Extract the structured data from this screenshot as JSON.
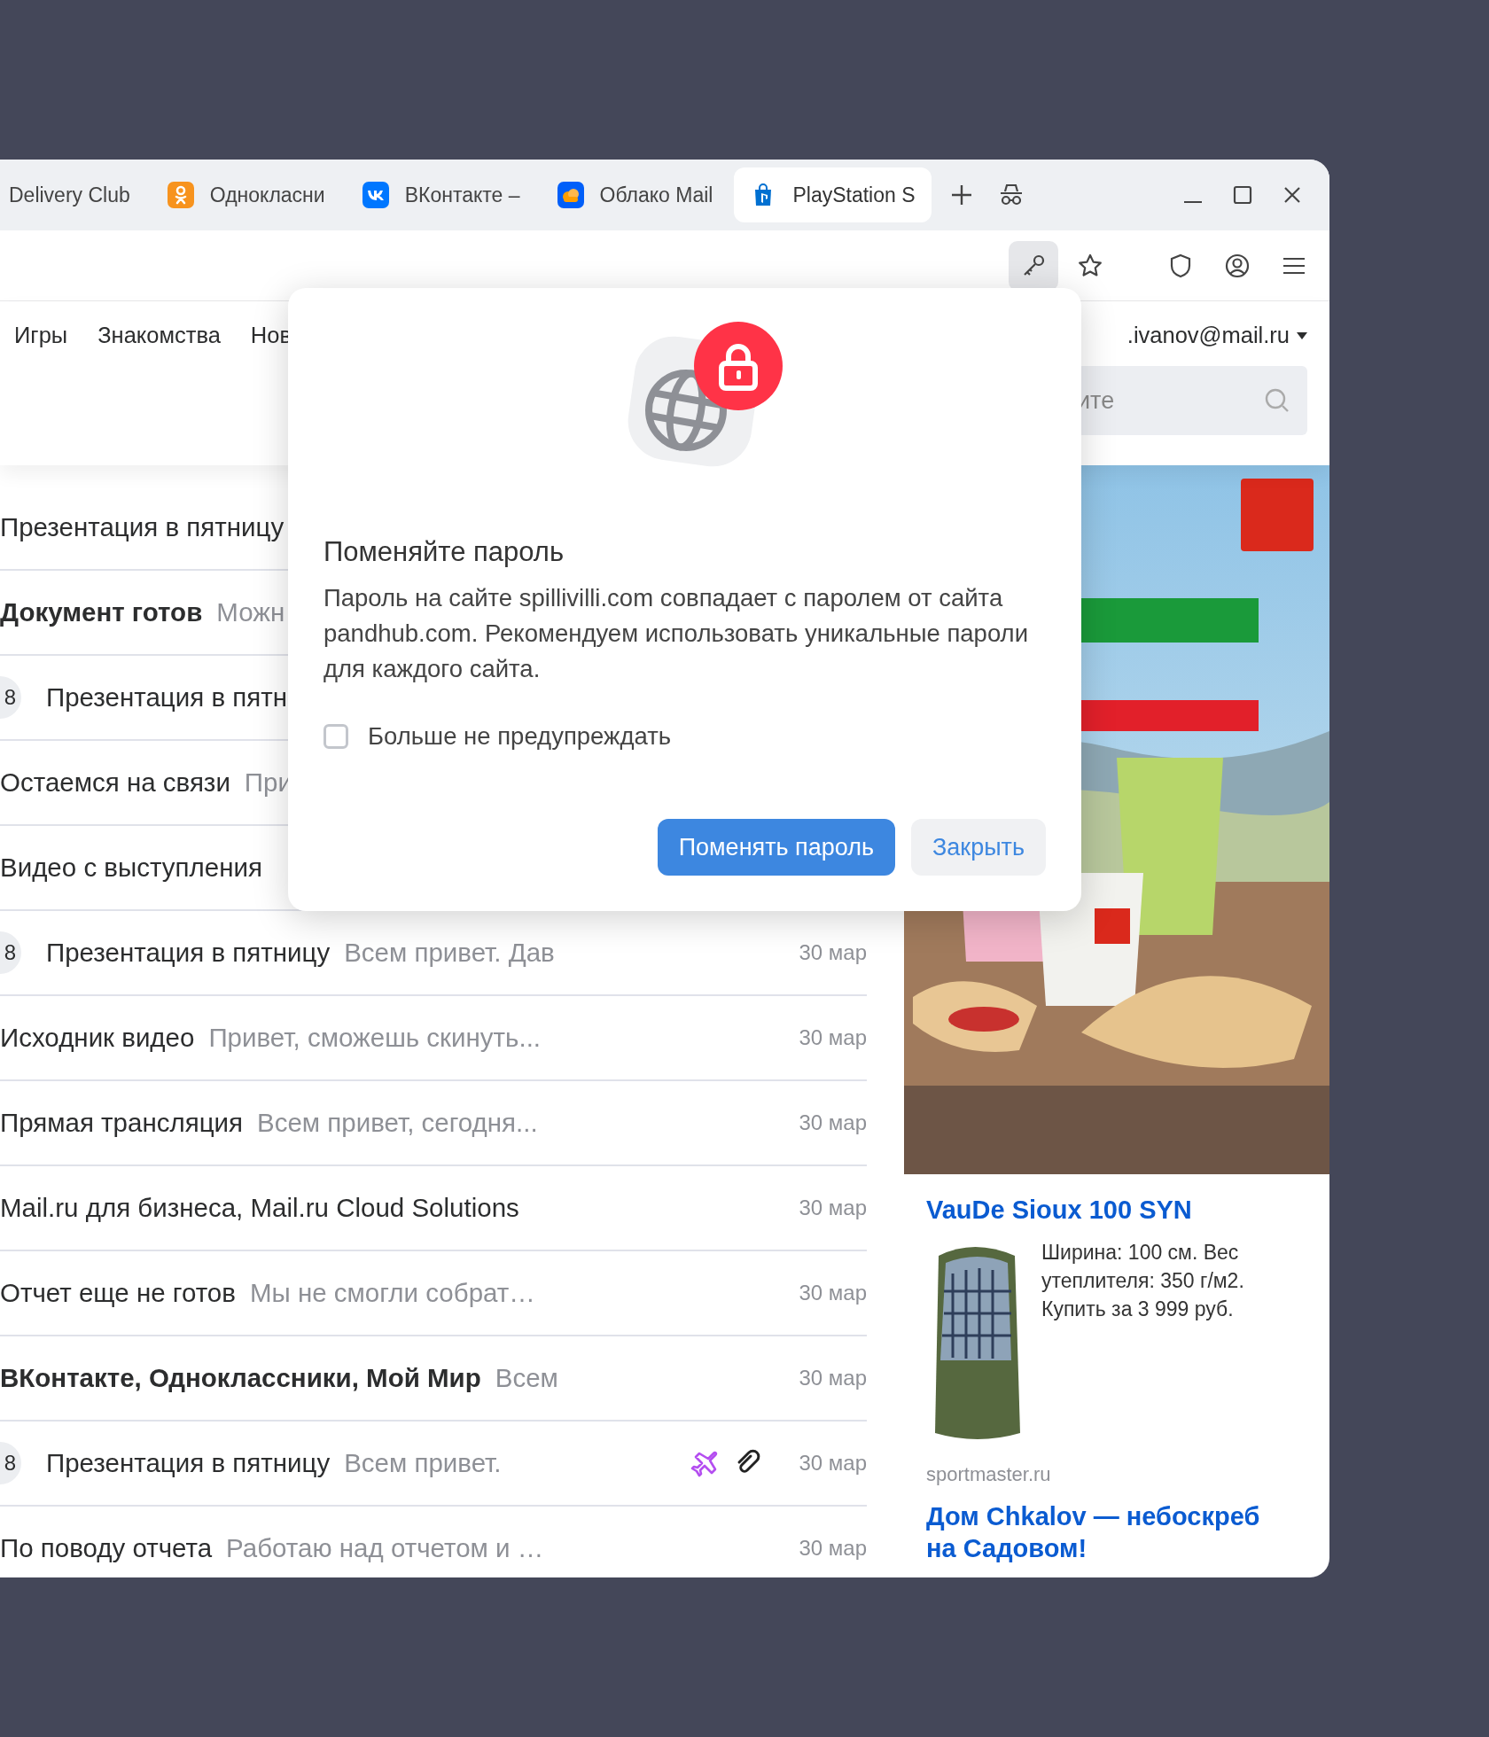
{
  "tabs": [
    {
      "label": "Delivery Club",
      "kind": "plain",
      "selected": false
    },
    {
      "label": "Однокласни",
      "kind": "ok",
      "selected": false
    },
    {
      "label": "ВКонтакте –",
      "kind": "vk",
      "selected": false
    },
    {
      "label": "Облако Mail",
      "kind": "cloud",
      "selected": false
    },
    {
      "label": "PlayStation S",
      "kind": "playstation",
      "selected": true
    }
  ],
  "nav": [
    "Игры",
    "Знакомства",
    "Нов"
  ],
  "account": ".ivanov@mail.ru",
  "search": {
    "placeholder": "ите"
  },
  "messages": [
    {
      "subject": "Презентация в пятницу",
      "unread": false,
      "attachment": false,
      "travel": false
    },
    {
      "subject": "Документ готов",
      "preview": "Можн",
      "unread": true,
      "attachment": false,
      "travel": false
    },
    {
      "count": "8",
      "subject": "Презентация в пятн",
      "unread": false,
      "attachment": false,
      "travel": false
    },
    {
      "subject": "Остаемся на связи",
      "preview": "При",
      "unread": false,
      "attachment": false,
      "travel": false
    },
    {
      "subject": "Видео с выступления",
      "unread": false,
      "attachment": false,
      "travel": false
    },
    {
      "count": "8",
      "subject": "Презентация в пятницу",
      "preview": "Всем привет. Дав",
      "date": "30 мар",
      "unread": false,
      "attachment": false,
      "travel": false
    },
    {
      "subject": "Исходник видео",
      "preview": "Привет, сможешь скинуть...",
      "date": "30 мар",
      "unread": false,
      "attachment": false,
      "travel": false
    },
    {
      "subject": "Прямая трансляция",
      "preview": "Всем привет, сегодня...",
      "date": "30 мар",
      "unread": false,
      "attachment": false,
      "travel": false
    },
    {
      "subject": "Mail.ru для бизнеса, Mail.ru Cloud Solutions",
      "date": "30 мар",
      "unread": false,
      "attachment": false,
      "travel": false
    },
    {
      "subject": "Отчет еще не готов",
      "preview": "Мы не смогли собрат…",
      "date": "30 мар",
      "unread": false,
      "attachment": false,
      "travel": false
    },
    {
      "subject": "ВКонтакте, Одноклассники, Мой Мир",
      "preview": "Всем",
      "date": "30 мар",
      "unread": true,
      "attachment": false,
      "travel": false
    },
    {
      "count": "8",
      "subject": "Презентация в пятницу",
      "preview": "Всем привет.",
      "date": "30 мар",
      "unread": false,
      "attachment": true,
      "travel": true
    },
    {
      "subject": "По поводу отчета",
      "preview": "Работаю над отчетом и …",
      "date": "30 мар",
      "unread": false,
      "attachment": false,
      "travel": false
    }
  ],
  "ads": [
    {
      "title": "VauDe Sioux 100 SYN",
      "text": "Ширина: 100 см. Вес утеплителя: 350 г/м2. Купить за 3 999 руб.",
      "domain": "sportmaster.ru"
    },
    {
      "title": "Дом Chkalov — небоскреб на Садовом!"
    }
  ],
  "dialog": {
    "title": "Поменяйте пароль",
    "body": "Пароль на сайте spillivilli.com совпадает с паролем от сайта pandhub.com. Рекомендуем использовать уникальные пароли для каждого сайта.",
    "checkbox": {
      "label": "Больше не предупреждать",
      "checked": false
    },
    "buttons": [
      {
        "label": "Поменять пароль",
        "kind": "primary"
      },
      {
        "label": "Закрыть",
        "kind": "secondary"
      }
    ]
  }
}
